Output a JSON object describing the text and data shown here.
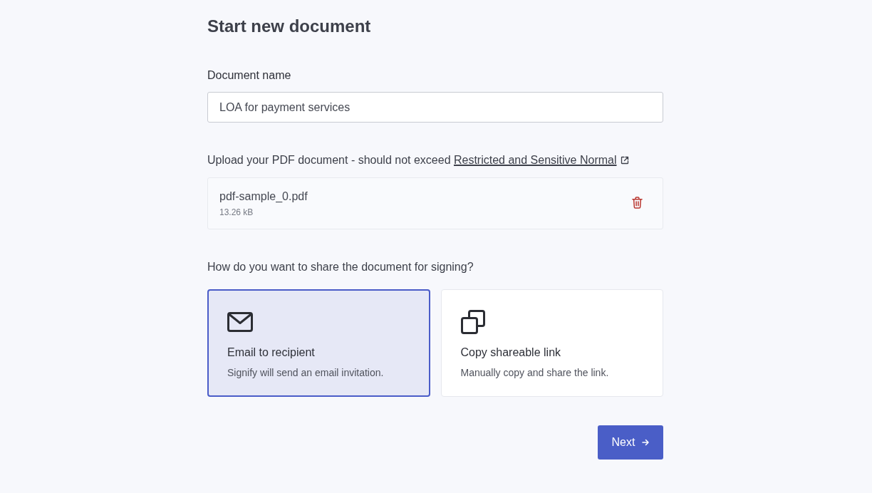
{
  "title": "Start new document",
  "document_name": {
    "label": "Document name",
    "value": "LOA for payment services"
  },
  "upload": {
    "label": "Upload your PDF document - should not exceed",
    "link": "Restricted and Sensitive Normal",
    "file": {
      "name": "pdf-sample_0.pdf",
      "size": "13.26 kB"
    }
  },
  "share": {
    "question": "How do you want to share the document for signing?",
    "options": [
      {
        "kind": "email",
        "title": "Email to recipient",
        "description": "Signify will send an email invitation.",
        "selected": true
      },
      {
        "kind": "link",
        "title": "Copy shareable link",
        "description": "Manually copy and share the link.",
        "selected": false
      }
    ]
  },
  "next_button": {
    "label": "Next"
  }
}
